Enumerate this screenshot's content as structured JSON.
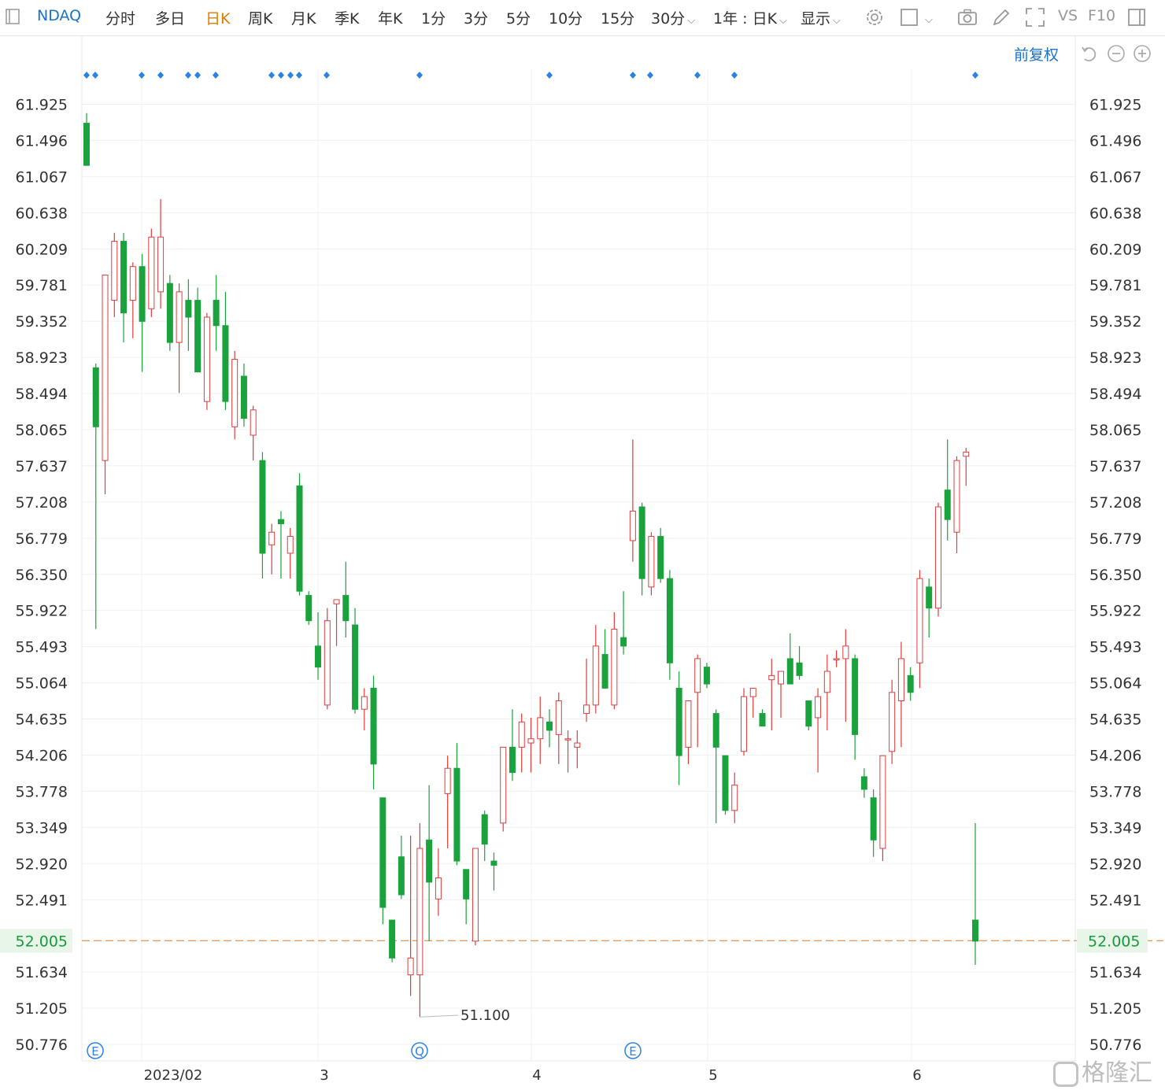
{
  "toolbar": {
    "symbol": "NDAQ",
    "periods": [
      "分时",
      "多日",
      "日K",
      "周K",
      "月K",
      "季K",
      "年K",
      "1分",
      "3分",
      "5分",
      "10分",
      "15分",
      "30分"
    ],
    "active_period": "日K",
    "range_label": "1年 : 日K",
    "display_label": "显示",
    "vs_label": "VS",
    "f10_label": "F10",
    "icons": [
      "window-icon",
      "gear-icon",
      "square-icon",
      "camera-icon",
      "pencil-icon",
      "fullscreen-icon",
      "panel-icon"
    ]
  },
  "subbar": {
    "adjust_label": "前复权",
    "icons": [
      "undo-icon",
      "zoom-out-icon",
      "zoom-in-icon"
    ]
  },
  "watermark": "格隆汇",
  "colors": {
    "up": "#e03c3c",
    "down": "#1aa33c",
    "grid": "#f0f0f0",
    "price_line": "#e0a060",
    "marker": "#2a82e4",
    "price_tag_bg": "#e8f6ea"
  },
  "chart_data": {
    "type": "candlestick",
    "y_ticks": [
      "61.925",
      "61.496",
      "61.067",
      "60.638",
      "60.209",
      "59.781",
      "59.352",
      "58.923",
      "58.494",
      "58.065",
      "57.637",
      "57.208",
      "56.779",
      "56.350",
      "55.922",
      "55.493",
      "55.064",
      "54.635",
      "54.206",
      "53.778",
      "53.349",
      "52.920",
      "52.491",
      "51.634",
      "51.205",
      "50.776"
    ],
    "ylim": [
      50.58,
      62.34
    ],
    "x_labels": [
      "2023/02",
      "3",
      "4",
      "5",
      "6"
    ],
    "current_price": "52.005",
    "low_annotation": "51.100",
    "event_markers": [
      "E",
      "Q",
      "E"
    ],
    "candles": [
      {
        "o": 61.7,
        "h": 61.82,
        "l": 61.5,
        "c": 61.2
      },
      {
        "o": 58.8,
        "h": 58.85,
        "l": 55.7,
        "c": 58.1
      },
      {
        "o": 57.7,
        "h": 59.9,
        "l": 57.3,
        "c": 59.9
      },
      {
        "o": 59.6,
        "h": 60.4,
        "l": 59.4,
        "c": 60.3
      },
      {
        "o": 60.3,
        "h": 60.4,
        "l": 59.1,
        "c": 59.45
      },
      {
        "o": 59.6,
        "h": 60.05,
        "l": 59.15,
        "c": 60.0
      },
      {
        "o": 60.0,
        "h": 60.15,
        "l": 58.75,
        "c": 59.35
      },
      {
        "o": 59.5,
        "h": 60.45,
        "l": 59.4,
        "c": 60.35
      },
      {
        "o": 59.7,
        "h": 60.8,
        "l": 59.5,
        "c": 60.35
      },
      {
        "o": 59.8,
        "h": 59.9,
        "l": 59.0,
        "c": 59.1
      },
      {
        "o": 59.1,
        "h": 59.8,
        "l": 58.5,
        "c": 59.7
      },
      {
        "o": 59.6,
        "h": 59.85,
        "l": 59.0,
        "c": 59.4
      },
      {
        "o": 59.6,
        "h": 59.75,
        "l": 58.75,
        "c": 58.75
      },
      {
        "o": 58.4,
        "h": 59.45,
        "l": 58.3,
        "c": 59.4
      },
      {
        "o": 59.6,
        "h": 59.9,
        "l": 59.0,
        "c": 59.3
      },
      {
        "o": 59.3,
        "h": 59.7,
        "l": 58.3,
        "c": 58.4
      },
      {
        "o": 58.1,
        "h": 59.0,
        "l": 57.95,
        "c": 58.9
      },
      {
        "o": 58.7,
        "h": 58.85,
        "l": 58.1,
        "c": 58.2
      },
      {
        "o": 58.0,
        "h": 58.35,
        "l": 57.7,
        "c": 58.3
      },
      {
        "o": 57.7,
        "h": 57.8,
        "l": 56.3,
        "c": 56.6
      },
      {
        "o": 56.7,
        "h": 56.95,
        "l": 56.35,
        "c": 56.85
      },
      {
        "o": 57.0,
        "h": 57.1,
        "l": 56.3,
        "c": 56.95
      },
      {
        "o": 56.6,
        "h": 56.9,
        "l": 56.3,
        "c": 56.8
      },
      {
        "o": 57.4,
        "h": 57.55,
        "l": 56.1,
        "c": 56.15
      },
      {
        "o": 56.1,
        "h": 56.15,
        "l": 55.75,
        "c": 55.8
      },
      {
        "o": 55.5,
        "h": 55.9,
        "l": 55.1,
        "c": 55.25
      },
      {
        "o": 54.8,
        "h": 55.95,
        "l": 54.75,
        "c": 55.8
      },
      {
        "o": 56.0,
        "h": 56.05,
        "l": 55.5,
        "c": 56.05
      },
      {
        "o": 56.1,
        "h": 56.5,
        "l": 55.6,
        "c": 55.8
      },
      {
        "o": 55.75,
        "h": 55.95,
        "l": 54.7,
        "c": 54.75
      },
      {
        "o": 54.75,
        "h": 55.0,
        "l": 54.5,
        "c": 54.9
      },
      {
        "o": 55.0,
        "h": 55.15,
        "l": 53.8,
        "c": 54.1
      },
      {
        "o": 53.7,
        "h": 53.7,
        "l": 52.2,
        "c": 52.4
      },
      {
        "o": 52.25,
        "h": 52.25,
        "l": 51.75,
        "c": 51.8
      },
      {
        "o": 53.0,
        "h": 53.25,
        "l": 52.5,
        "c": 52.55
      },
      {
        "o": 51.6,
        "h": 53.25,
        "l": 51.35,
        "c": 51.8
      },
      {
        "o": 51.6,
        "h": 53.4,
        "l": 51.1,
        "c": 53.1
      },
      {
        "o": 53.2,
        "h": 53.85,
        "l": 52.0,
        "c": 52.7
      },
      {
        "o": 52.5,
        "h": 53.1,
        "l": 52.3,
        "c": 52.75
      },
      {
        "o": 53.75,
        "h": 54.2,
        "l": 53.1,
        "c": 54.05
      },
      {
        "o": 54.05,
        "h": 54.35,
        "l": 52.9,
        "c": 52.95
      },
      {
        "o": 52.85,
        "h": 52.85,
        "l": 52.2,
        "c": 52.5
      },
      {
        "o": 52.0,
        "h": 53.1,
        "l": 51.95,
        "c": 53.1
      },
      {
        "o": 53.5,
        "h": 53.55,
        "l": 52.95,
        "c": 53.15
      },
      {
        "o": 52.95,
        "h": 53.05,
        "l": 52.6,
        "c": 52.9
      },
      {
        "o": 53.4,
        "h": 54.3,
        "l": 53.3,
        "c": 54.3
      },
      {
        "o": 54.3,
        "h": 54.75,
        "l": 53.9,
        "c": 54.0
      },
      {
        "o": 54.3,
        "h": 54.7,
        "l": 54.0,
        "c": 54.6
      },
      {
        "o": 54.35,
        "h": 54.65,
        "l": 54.0,
        "c": 54.4
      },
      {
        "o": 54.4,
        "h": 54.9,
        "l": 54.1,
        "c": 54.65
      },
      {
        "o": 54.6,
        "h": 54.75,
        "l": 54.3,
        "c": 54.5
      },
      {
        "o": 54.45,
        "h": 54.95,
        "l": 54.1,
        "c": 54.85
      },
      {
        "o": 54.4,
        "h": 54.5,
        "l": 54.0,
        "c": 54.4
      },
      {
        "o": 54.3,
        "h": 54.5,
        "l": 54.05,
        "c": 54.35
      },
      {
        "o": 54.7,
        "h": 55.35,
        "l": 54.6,
        "c": 54.8
      },
      {
        "o": 54.8,
        "h": 55.75,
        "l": 54.7,
        "c": 55.5
      },
      {
        "o": 55.4,
        "h": 55.7,
        "l": 55.0,
        "c": 55.0
      },
      {
        "o": 54.8,
        "h": 55.9,
        "l": 54.75,
        "c": 55.7
      },
      {
        "o": 55.6,
        "h": 56.15,
        "l": 55.4,
        "c": 55.5
      },
      {
        "o": 56.75,
        "h": 57.95,
        "l": 56.5,
        "c": 57.1
      },
      {
        "o": 57.15,
        "h": 57.2,
        "l": 56.1,
        "c": 56.3
      },
      {
        "o": 56.2,
        "h": 56.85,
        "l": 56.1,
        "c": 56.8
      },
      {
        "o": 56.8,
        "h": 56.9,
        "l": 56.25,
        "c": 56.3
      },
      {
        "o": 56.3,
        "h": 56.4,
        "l": 55.1,
        "c": 55.3
      },
      {
        "o": 55.0,
        "h": 55.2,
        "l": 53.85,
        "c": 54.2
      },
      {
        "o": 54.3,
        "h": 54.85,
        "l": 54.1,
        "c": 54.85
      },
      {
        "o": 54.95,
        "h": 55.4,
        "l": 54.3,
        "c": 55.35
      },
      {
        "o": 55.25,
        "h": 55.3,
        "l": 55.0,
        "c": 55.05
      },
      {
        "o": 54.7,
        "h": 54.75,
        "l": 53.4,
        "c": 54.3
      },
      {
        "o": 54.2,
        "h": 54.2,
        "l": 53.5,
        "c": 53.55
      },
      {
        "o": 53.55,
        "h": 54.0,
        "l": 53.4,
        "c": 53.85
      },
      {
        "o": 54.25,
        "h": 55.0,
        "l": 54.2,
        "c": 54.9
      },
      {
        "o": 54.9,
        "h": 55.0,
        "l": 54.65,
        "c": 55.0
      },
      {
        "o": 54.7,
        "h": 54.75,
        "l": 54.55,
        "c": 54.55
      },
      {
        "o": 55.1,
        "h": 55.35,
        "l": 54.5,
        "c": 55.15
      },
      {
        "o": 55.05,
        "h": 55.2,
        "l": 54.65,
        "c": 55.2
      },
      {
        "o": 55.35,
        "h": 55.65,
        "l": 55.05,
        "c": 55.05
      },
      {
        "o": 55.3,
        "h": 55.5,
        "l": 55.1,
        "c": 55.15
      },
      {
        "o": 54.85,
        "h": 54.85,
        "l": 54.5,
        "c": 54.55
      },
      {
        "o": 54.65,
        "h": 55.0,
        "l": 54.0,
        "c": 54.9
      },
      {
        "o": 54.95,
        "h": 55.4,
        "l": 54.5,
        "c": 55.2
      },
      {
        "o": 55.35,
        "h": 55.45,
        "l": 55.25,
        "c": 55.35
      },
      {
        "o": 55.35,
        "h": 55.7,
        "l": 54.6,
        "c": 55.5
      },
      {
        "o": 55.35,
        "h": 55.4,
        "l": 54.15,
        "c": 54.45
      },
      {
        "o": 53.95,
        "h": 54.05,
        "l": 53.7,
        "c": 53.8
      },
      {
        "o": 53.7,
        "h": 53.8,
        "l": 53.0,
        "c": 53.2
      },
      {
        "o": 53.1,
        "h": 54.2,
        "l": 52.95,
        "c": 54.2
      },
      {
        "o": 54.25,
        "h": 55.1,
        "l": 54.1,
        "c": 54.95
      },
      {
        "o": 54.85,
        "h": 55.55,
        "l": 54.3,
        "c": 55.35
      },
      {
        "o": 55.15,
        "h": 55.25,
        "l": 54.85,
        "c": 54.95
      },
      {
        "o": 55.3,
        "h": 56.4,
        "l": 55.0,
        "c": 56.3
      },
      {
        "o": 56.2,
        "h": 56.3,
        "l": 55.6,
        "c": 55.95
      },
      {
        "o": 55.95,
        "h": 57.2,
        "l": 55.85,
        "c": 57.15
      },
      {
        "o": 57.35,
        "h": 57.95,
        "l": 56.75,
        "c": 57.0
      },
      {
        "o": 56.85,
        "h": 57.75,
        "l": 56.6,
        "c": 57.7
      },
      {
        "o": 57.75,
        "h": 57.85,
        "l": 57.4,
        "c": 57.8
      },
      {
        "o": 52.25,
        "h": 53.4,
        "l": 51.72,
        "c": 52.0
      }
    ]
  }
}
